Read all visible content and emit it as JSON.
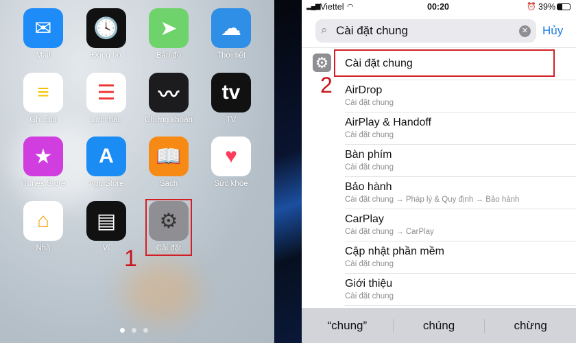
{
  "home_screen": {
    "apps": [
      {
        "label": "Mail",
        "icon": "mail-icon",
        "color": "#1d8cf8"
      },
      {
        "label": "Đồng hồ",
        "icon": "clock-icon",
        "color": "#111111"
      },
      {
        "label": "Bản đồ",
        "icon": "maps-icon",
        "color": "#6fd36b"
      },
      {
        "label": "Thời tiết",
        "icon": "weather-icon",
        "color": "#2f8fe6"
      },
      {
        "label": "Ghi chú",
        "icon": "notes-icon",
        "color": "#ffffff"
      },
      {
        "label": "Lời nhắc",
        "icon": "reminders-icon",
        "color": "#ffffff"
      },
      {
        "label": "Chứng khoán",
        "icon": "stocks-icon",
        "color": "#1c1c1e"
      },
      {
        "label": "TV",
        "icon": "apple-tv-icon",
        "color": "#111111"
      },
      {
        "label": "iTunes Store",
        "icon": "star-icon",
        "color": "#d03ee0"
      },
      {
        "label": "App Store",
        "icon": "app-store-icon",
        "color": "#1a8cf3"
      },
      {
        "label": "Sách",
        "icon": "books-icon",
        "color": "#f78a14"
      },
      {
        "label": "Sức khỏe",
        "icon": "heart-icon",
        "color": "#ffffff"
      },
      {
        "label": "Nhà",
        "icon": "home-icon",
        "color": "#ffffff"
      },
      {
        "label": "Ví",
        "icon": "wallet-icon",
        "color": "#111111"
      },
      {
        "label": "Cài đặt",
        "icon": "gear-icon",
        "color": "#8e8e93"
      }
    ],
    "step_label": "1",
    "page_count": 3,
    "current_page": 1
  },
  "settings_search": {
    "status": {
      "carrier": "Viettel",
      "time": "00:20",
      "battery": "39%"
    },
    "search_value": "Cài đặt chung",
    "cancel_label": "Hủy",
    "step_label": "2",
    "results": [
      {
        "title": "Cài đặt chung",
        "subtitle": ""
      },
      {
        "title": "AirDrop",
        "subtitle": "Cài đặt chung"
      },
      {
        "title": "AirPlay & Handoff",
        "subtitle": "Cài đặt chung"
      },
      {
        "title": "Bàn phím",
        "subtitle": "Cài đặt chung"
      },
      {
        "title": "Bảo hành",
        "subtitle": "Cài đặt chung → Pháp lý & Quy định → Bảo hành"
      },
      {
        "title": "CarPlay",
        "subtitle": "Cài đặt chung → CarPlay"
      },
      {
        "title": "Cập nhật phần mềm",
        "subtitle": "Cài đặt chung"
      },
      {
        "title": "Giới thiệu",
        "subtitle": "Cài đặt chung"
      }
    ],
    "suggestions": [
      "“chung”",
      "chúng",
      "chừng"
    ],
    "highlight_color": "#d21f26",
    "accent_color": "#1a7de0"
  }
}
